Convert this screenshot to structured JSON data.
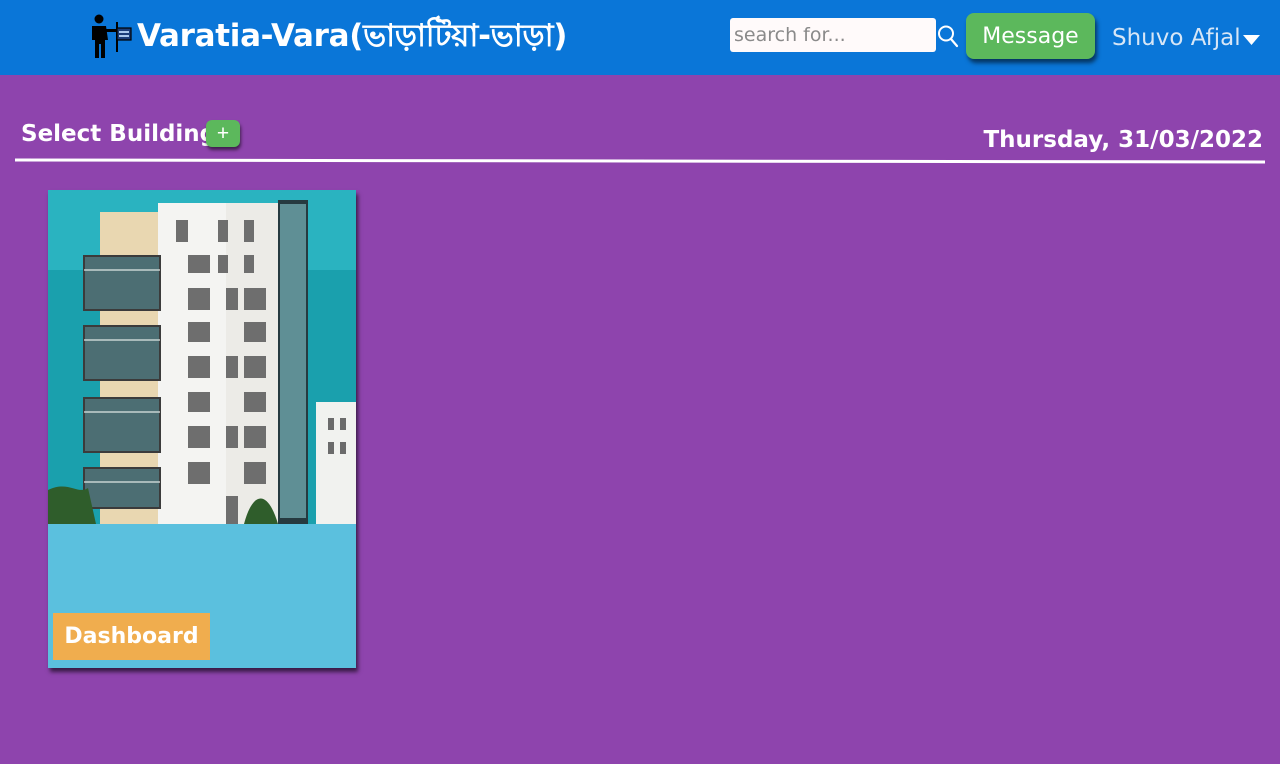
{
  "app": {
    "title": "Varatia-Vara(ভাড়াটিয়া-ভাড়া)",
    "logo_icon": "person-with-rent-sign-icon"
  },
  "header": {
    "search_placeholder": "search for...",
    "search_icon": "search-icon",
    "message_label": "Message",
    "user_name": "Shuvo Afjal",
    "user_caret_icon": "caret-down-icon"
  },
  "page": {
    "section_title": "Select Building",
    "add_building_label": "+",
    "date": "Thursday, 31/03/2022"
  },
  "buildings": [
    {
      "image_icon": "apartment-building-photo",
      "dashboard_label": "Dashboard"
    }
  ],
  "colors": {
    "navbar": "#0a76d8",
    "page_background": "#8e44ad",
    "success_button": "#5cb85c",
    "card_background": "#5bc0de",
    "dashboard_button": "#f0ad4e"
  }
}
